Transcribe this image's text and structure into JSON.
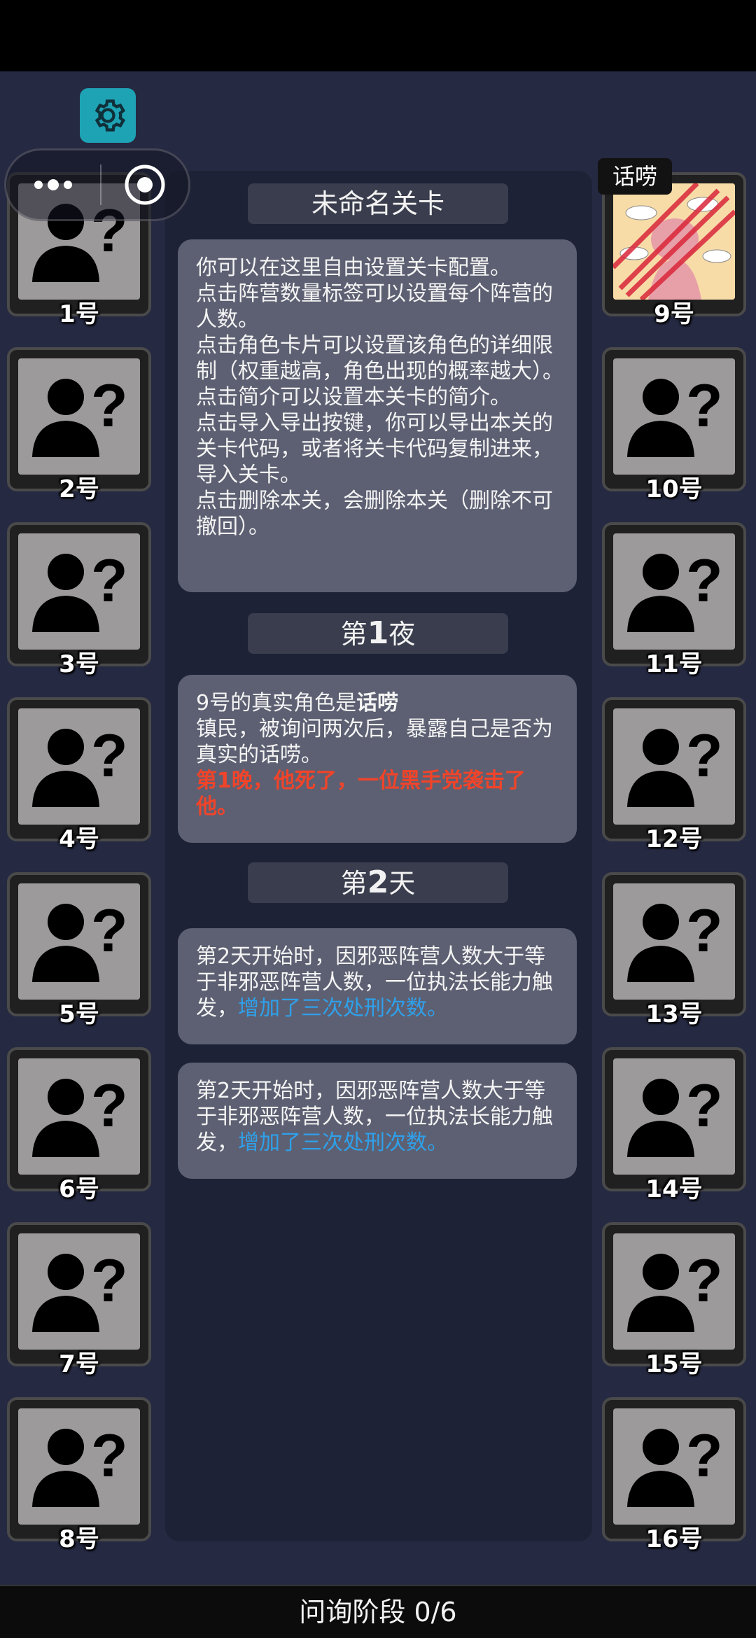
{
  "level_title": "未命名关卡",
  "intro_lines": [
    "你可以在这里自由设置关卡配置。",
    "点击阵营数量标签可以设置每个阵营的人数。",
    "点击角色卡片可以设置该角色的详细限制（权重越高，角色出现的概率越大）。",
    "点击简介可以设置本关卡的简介。",
    "点击导入导出按键，你可以导出本关的关卡代码，或者将关卡代码复制进来，导入关卡。",
    "点击删除本关，会删除本关（删除不可撤回）。"
  ],
  "night1": {
    "prefix": "第",
    "number": "1",
    "suffix": "夜",
    "line1_prefix": "9号的真实角色是",
    "line1_role": "话唠",
    "line2": "镇民，被询问两次后，暴露自己是否为真实的话唠。",
    "death_text": "第1晚，他死了，一位黑手党袭击了他。"
  },
  "day2": {
    "prefix": "第",
    "number": "2",
    "suffix": "天",
    "msg1_text": "第2天开始时，因邪恶阵营人数大于等于非邪恶阵营人数，一位执法长能力触发，",
    "msg1_highlight": "增加了三次处刑次数。",
    "msg2_text": "第2天开始时，因邪恶阵营人数大于等于非邪恶阵营人数，一位执法长能力触发，",
    "msg2_highlight": "增加了三次处刑次数。"
  },
  "revealed_role_tag": "话唠",
  "players_left": [
    "1号",
    "2号",
    "3号",
    "4号",
    "5号",
    "6号",
    "7号",
    "8号"
  ],
  "players_right": [
    "9号",
    "10号",
    "11号",
    "12号",
    "13号",
    "14号",
    "15号",
    "16号"
  ],
  "phase_label": "问询阶段 0/6",
  "icons": {
    "settings": "gear-icon",
    "menu": "more-dots-icon",
    "close": "target-circle-icon",
    "unknown_player": "unknown-person-icon"
  },
  "colors": {
    "accent_teal": "#1ea3b5",
    "highlight_red": "#f0442a",
    "highlight_blue": "#2fa0ea",
    "background": "#252941"
  }
}
